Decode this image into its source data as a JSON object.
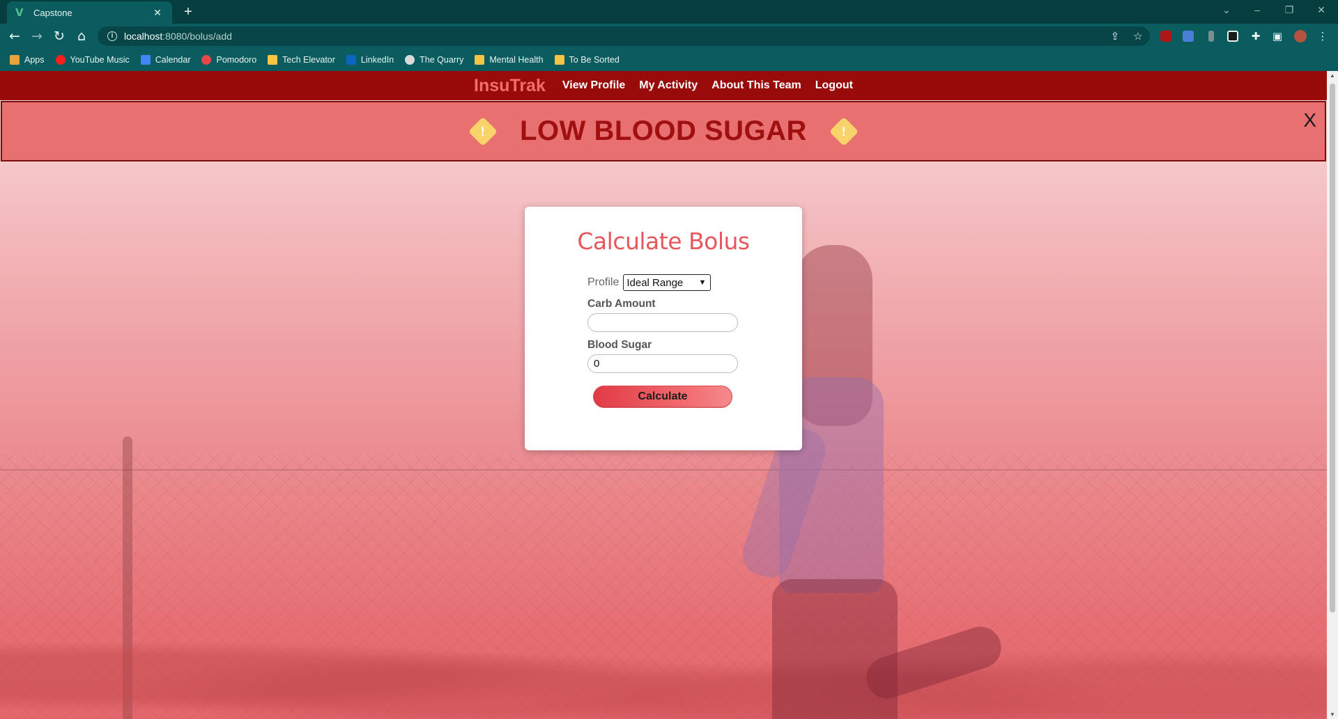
{
  "browser": {
    "tab_title": "Capstone",
    "tab_close": "✕",
    "new_tab": "+",
    "url_host": "localhost",
    "url_path": ":8080/bolus/add",
    "bookmarks": [
      {
        "label": "Apps",
        "icon": "apps-grid-icon",
        "color": "#e8a33d"
      },
      {
        "label": "YouTube Music",
        "icon": "youtube-music-icon",
        "color": "#ff1e1e"
      },
      {
        "label": "Calendar",
        "icon": "calendar-icon",
        "color": "#4285f4"
      },
      {
        "label": "Pomodoro",
        "icon": "pomodoro-icon",
        "color": "#e54848"
      },
      {
        "label": "Tech Elevator",
        "icon": "folder-icon",
        "color": "#f6c445"
      },
      {
        "label": "LinkedIn",
        "icon": "linkedin-icon",
        "color": "#0a66c2"
      },
      {
        "label": "The Quarry",
        "icon": "quarry-icon",
        "color": "#d9d9d9"
      },
      {
        "label": "Mental Health",
        "icon": "folder-icon",
        "color": "#f6c445"
      },
      {
        "label": "To Be Sorted",
        "icon": "folder-icon",
        "color": "#f6c445"
      }
    ]
  },
  "navbar": {
    "brand": "InsuTrak",
    "links": [
      "View Profile",
      "My Activity",
      "About This Team",
      "Logout"
    ]
  },
  "alert": {
    "text": "LOW BLOOD SUGAR",
    "warning_symbol": "!",
    "close": "X"
  },
  "form": {
    "title": "Calculate Bolus",
    "profile_label": "Profile",
    "profile_selected": "Ideal Range",
    "carb_label": "Carb Amount",
    "carb_value": "",
    "blood_sugar_label": "Blood Sugar",
    "blood_sugar_value": "0",
    "submit_label": "Calculate"
  },
  "colors": {
    "navbar": "#990a0a",
    "brand": "#f26d6d",
    "alert_bg": "#e87070",
    "alert_text": "#a01010",
    "accent": "#e8555a"
  }
}
